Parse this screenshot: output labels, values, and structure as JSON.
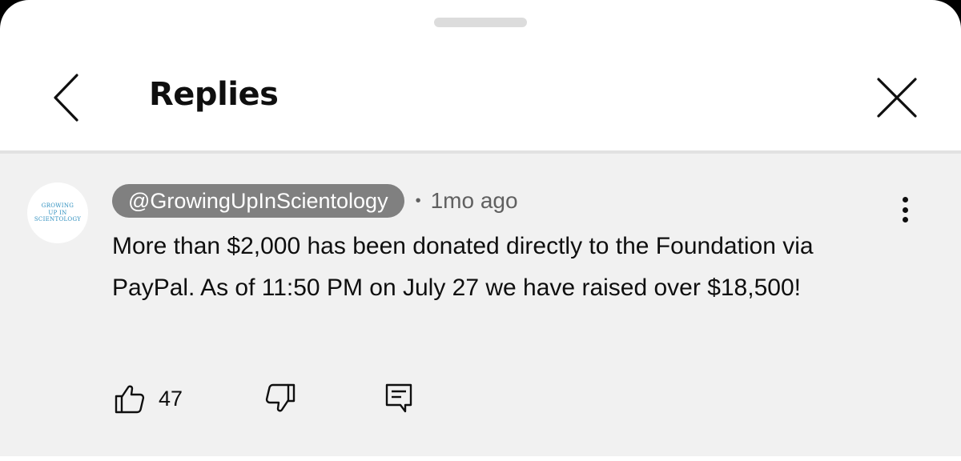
{
  "header": {
    "title": "Replies",
    "back_icon": "chevron-left-icon",
    "close_icon": "close-icon"
  },
  "comment": {
    "avatar": {
      "line1": "GROWING",
      "line2": "UP IN",
      "line3": "SCIENTOLOGY",
      "color": "#2e8fbf"
    },
    "channel": "@GrowingUpInScientology",
    "separator": "•",
    "time": "1mo ago",
    "text": "More than $2,000 has been donated directly to the Foundation via PayPal. As of 11:50 PM on July 27 we have raised over $18,500!",
    "like_count": "47",
    "icons": {
      "like": "thumbs-up-icon",
      "dislike": "thumbs-down-icon",
      "reply": "comment-reply-icon",
      "menu": "more-vertical-icon"
    }
  },
  "colors": {
    "content_background": "#f1f1f1",
    "channel_pill": "#808080",
    "secondary_text": "#606060"
  }
}
